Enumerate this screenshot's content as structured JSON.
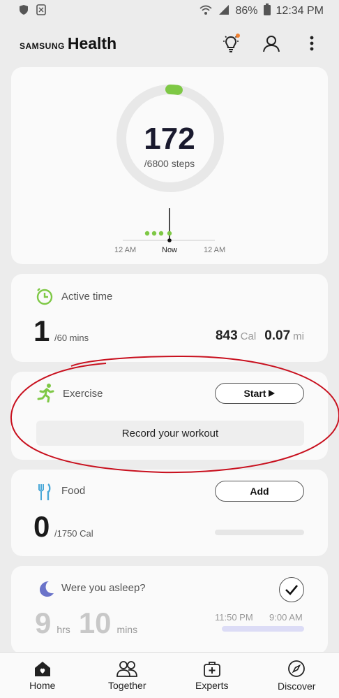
{
  "status_bar": {
    "battery": "86%",
    "time": "12:34 PM"
  },
  "app": {
    "brand_prefix": "SAMSUNG",
    "brand_name": "Health"
  },
  "steps": {
    "value": "172",
    "goal": "/6800 steps",
    "progress_fraction": 0.025,
    "timeline": {
      "start": "12 AM",
      "now": "Now",
      "end": "12 AM"
    }
  },
  "active_time": {
    "title": "Active time",
    "value": "1",
    "goal": "/60 mins",
    "calories": "843",
    "calories_unit": "Cal",
    "distance": "0.07",
    "distance_unit": "mi"
  },
  "exercise": {
    "title": "Exercise",
    "start_label": "Start",
    "record_label": "Record your workout"
  },
  "food": {
    "title": "Food",
    "add_label": "Add",
    "value": "0",
    "goal": "/1750 Cal"
  },
  "sleep": {
    "title": "Were you asleep?",
    "hours": "9",
    "hours_unit": "hrs",
    "mins": "10",
    "mins_unit": "mins",
    "start": "11:50 PM",
    "end": "9:00 AM"
  },
  "nav": [
    {
      "label": "Home",
      "icon": "home-icon"
    },
    {
      "label": "Together",
      "icon": "people-icon"
    },
    {
      "label": "Experts",
      "icon": "medical-kit-icon"
    },
    {
      "label": "Discover",
      "icon": "compass-icon"
    }
  ],
  "colors": {
    "accent_green": "#7ec845",
    "sleep_bar": "#dcdcf6",
    "annotation_red": "#c8101e"
  }
}
